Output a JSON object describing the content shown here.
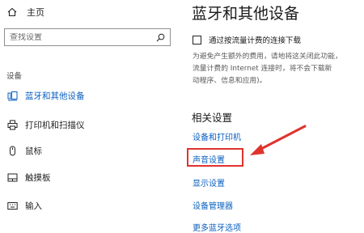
{
  "sidebar": {
    "home_label": "主页",
    "search_placeholder": "查找设置",
    "section_label": "设备",
    "items": [
      {
        "label": "蓝牙和其他设备",
        "icon": "bluetooth-devices-icon",
        "active": true
      },
      {
        "label": "打印机和扫描仪",
        "icon": "printer-icon",
        "active": false
      },
      {
        "label": "鼠标",
        "icon": "mouse-icon",
        "active": false
      },
      {
        "label": "触摸板",
        "icon": "touchpad-icon",
        "active": false
      },
      {
        "label": "输入",
        "icon": "keyboard-icon",
        "active": false
      }
    ]
  },
  "main": {
    "title": "蓝牙和其他设备",
    "metered_checkbox_label": "通过按流量计费的连接下载",
    "metered_checked": false,
    "description_lines": [
      "为避免产生额外的费用，请地将这关闭此功能，",
      "流量计费的 Internet 连接时，将不会下载新",
      "动程序、信息和应用)。"
    ],
    "related_title": "相关设置",
    "related_links": [
      "设备和打印机",
      "声音设置",
      "显示设置",
      "设备管理器",
      "更多蓝牙选项"
    ],
    "highlighted_link": "声音设置"
  },
  "colors": {
    "accent": "#0a5fbf",
    "annotation_red": "#e0332e"
  }
}
